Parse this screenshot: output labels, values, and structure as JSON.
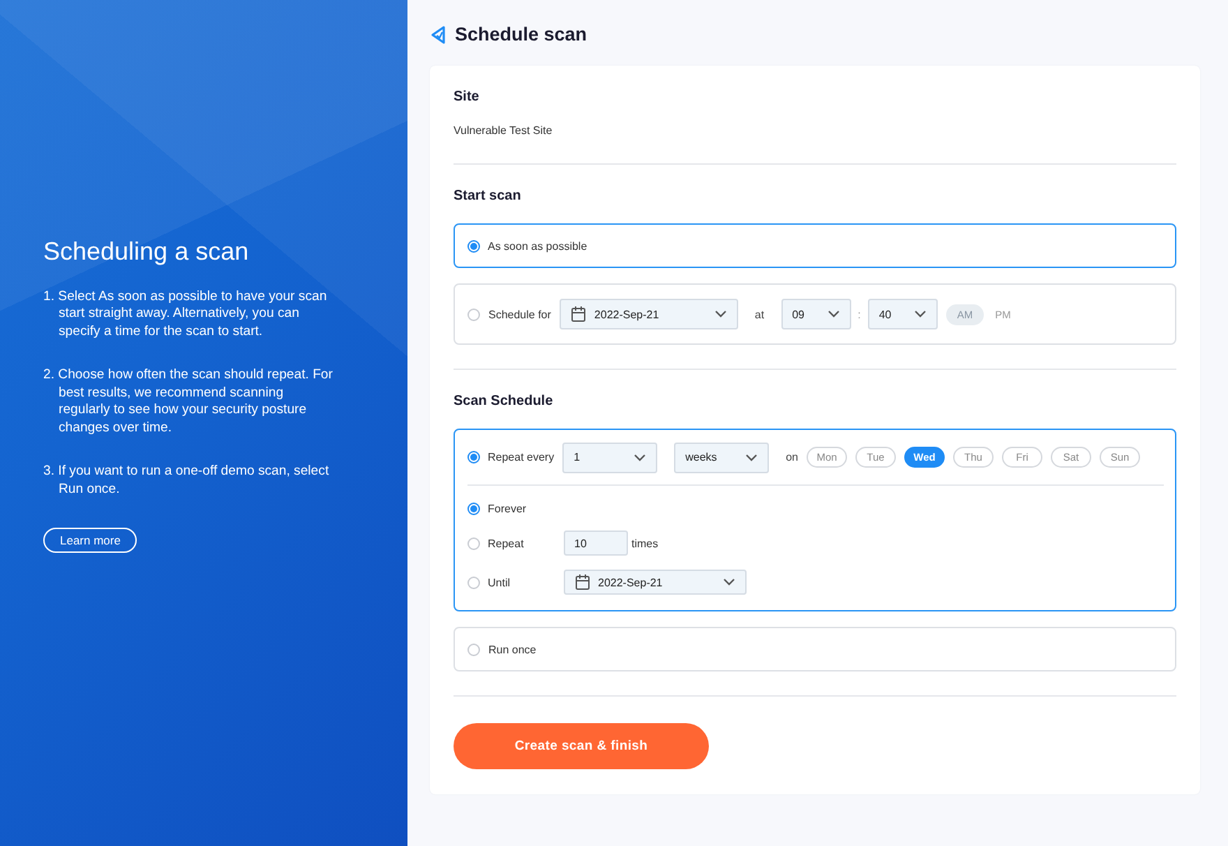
{
  "sidebar": {
    "title": "Scheduling a scan",
    "steps": [
      "1. Select As soon as possible to have your scan start straight away. Alternatively, you can specify a time for the scan to start.",
      "2. Choose how often the scan should repeat. For best results, we recommend scanning regularly to see how your security posture changes over time.",
      "3. If you want to run a one-off demo scan, select Run once."
    ],
    "learn_more": "Learn more"
  },
  "page": {
    "title": "Schedule scan"
  },
  "site": {
    "heading": "Site",
    "value": "Vulnerable Test Site"
  },
  "start_scan": {
    "heading": "Start scan",
    "options": [
      {
        "kind": "plain",
        "label": "As soon as possible",
        "selected": true
      },
      {
        "kind": "datetime",
        "label": "Schedule for",
        "selected": false,
        "date": "2022-Sep-21",
        "at": "at",
        "hour": "09",
        "separator": ":",
        "minute": "40",
        "meridiem": [
          {
            "label": "AM",
            "selected": true
          },
          {
            "label": "PM",
            "selected": false
          }
        ]
      }
    ]
  },
  "scan_schedule": {
    "heading": "Scan Schedule",
    "options": [
      {
        "kind": "repeat",
        "label": "Repeat every",
        "selected": true,
        "interval": "1",
        "unit": "weeks",
        "on": "on",
        "days": [
          {
            "label": "Mon",
            "selected": false
          },
          {
            "label": "Tue",
            "selected": false
          },
          {
            "label": "Wed",
            "selected": true
          },
          {
            "label": "Thu",
            "selected": false
          },
          {
            "label": "Fri",
            "selected": false
          },
          {
            "label": "Sat",
            "selected": false
          },
          {
            "label": "Sun",
            "selected": false
          }
        ],
        "ends": [
          {
            "kind": "plain",
            "label": "Forever",
            "selected": true
          },
          {
            "kind": "count",
            "label": "Repeat",
            "selected": false,
            "value": "10",
            "suffix": "times"
          },
          {
            "kind": "date",
            "label": "Until",
            "selected": false,
            "date": "2022-Sep-21"
          }
        ]
      },
      {
        "kind": "plain",
        "label": "Run once",
        "selected": false
      }
    ]
  },
  "submit": "Create scan & finish"
}
